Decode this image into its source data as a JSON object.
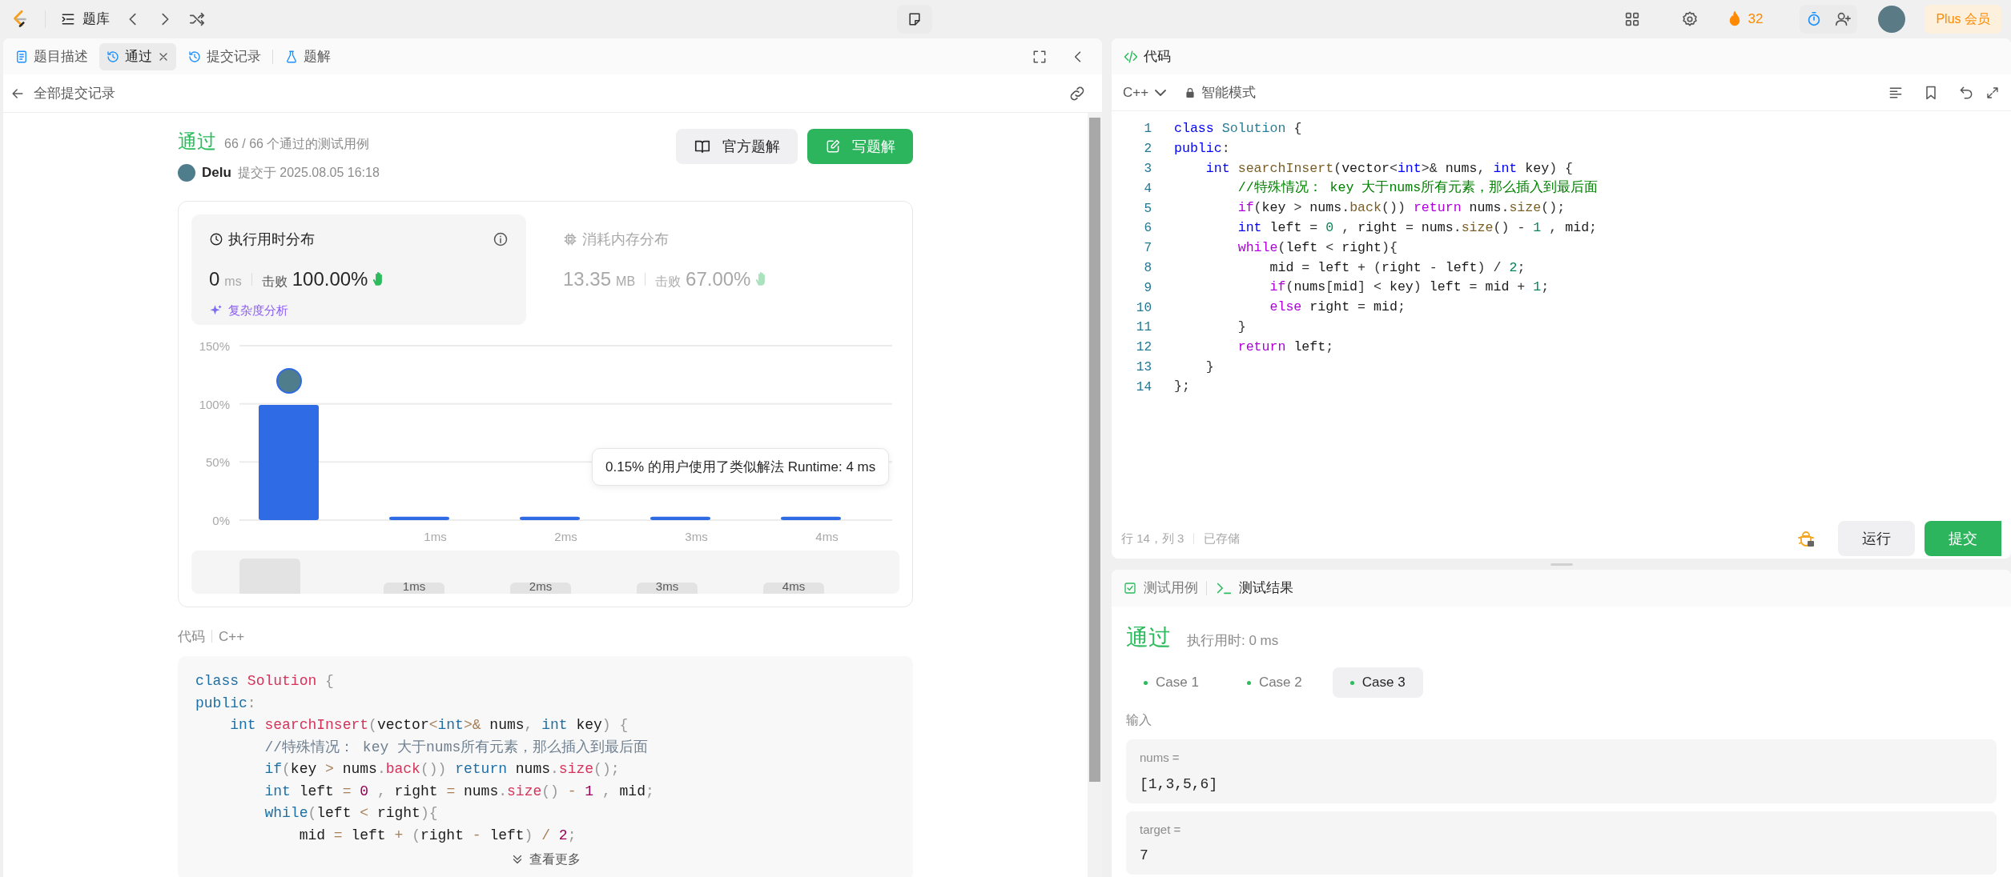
{
  "top_bar": {
    "problem_list": "题库",
    "streak": "32",
    "plus_button": "Plus 会员"
  },
  "left_tabs": [
    {
      "label": "题目描述",
      "selected": false,
      "closable": false
    },
    {
      "label": "通过",
      "selected": true,
      "closable": true
    },
    {
      "label": "提交记录",
      "selected": false,
      "closable": false
    },
    {
      "label": "题解",
      "selected": false,
      "closable": false
    }
  ],
  "back_link": "全部提交记录",
  "submission": {
    "status": "通过",
    "cases": "66 / 66 个通过的测试用例",
    "user": "Delu",
    "submitted": "提交于 2025.08.05 16:18",
    "buttons": [
      {
        "label": "官方题解",
        "kind": "secondary"
      },
      {
        "label": "写题解",
        "kind": "primary"
      }
    ]
  },
  "stats": [
    {
      "title": "执行用时分布",
      "value": "0",
      "unit": "ms",
      "beat_label": "击败",
      "beat": "100.00%",
      "selected": true
    },
    {
      "title": "消耗内存分布",
      "value": "13.35",
      "unit": "MB",
      "beat_label": "击败",
      "beat": "67.00%",
      "selected": false
    }
  ],
  "complexity_link": "复杂度分析",
  "chart_data": {
    "type": "bar",
    "categories": [
      null,
      "1ms",
      "2ms",
      "3ms",
      "4ms"
    ],
    "series": [
      {
        "color": "#2f6be4",
        "values": [
          99,
          3,
          3,
          3,
          3
        ]
      }
    ],
    "ylim": [
      0,
      150
    ],
    "yticks": [
      {
        "value": 0,
        "label": "0%"
      },
      {
        "value": 50,
        "label": "50%"
      },
      {
        "value": 100,
        "label": "100%"
      },
      {
        "value": 150,
        "label": "150%"
      }
    ],
    "annotations": [
      "0.15% 的用户使用了类似解法 Runtime: 4 ms"
    ]
  },
  "overview_labels": [
    "1ms",
    "2ms",
    "3ms",
    "4ms"
  ],
  "code_preview": {
    "label": "代码",
    "language": "C++",
    "more": "查看更多",
    "lines": [
      "class Solution {",
      "public:",
      "    int searchInsert(vector<int>& nums, int key) {",
      "        //特殊情况： key 大于nums所有元素，那么插入到最后面",
      "        if(key > nums.back()) return nums.size();",
      "        int left = 0 , right = nums.size() - 1 , mid;",
      "        while(left < right){",
      "            mid = left + (right - left) / 2;"
    ]
  },
  "editor": {
    "title": "代码",
    "language": "C++",
    "mode": "智能模式",
    "lines": [
      {
        "n": "1",
        "code": "class Solution {"
      },
      {
        "n": "2",
        "code": "public:"
      },
      {
        "n": "3",
        "code": "    int searchInsert(vector<int>& nums, int key) {"
      },
      {
        "n": "4",
        "code": "        //特殊情况： key 大于nums所有元素，那么插入到最后面"
      },
      {
        "n": "5",
        "code": "        if(key > nums.back()) return nums.size();"
      },
      {
        "n": "6",
        "code": "        int left = 0 , right = nums.size() - 1 , mid;"
      },
      {
        "n": "7",
        "code": "        while(left < right){"
      },
      {
        "n": "8",
        "code": "            mid = left + (right - left) / 2;"
      },
      {
        "n": "9",
        "code": "            if(nums[mid] < key) left = mid + 1;"
      },
      {
        "n": "10",
        "code": "            else right = mid;"
      },
      {
        "n": "11",
        "code": "        }"
      },
      {
        "n": "12",
        "code": "        return left;"
      },
      {
        "n": "13",
        "code": "    }"
      },
      {
        "n": "14",
        "code": "};"
      }
    ],
    "cursor": "行 14，列 3",
    "saved": "已存储",
    "run": "运行",
    "submit": "提交"
  },
  "test_panel": {
    "tabs": [
      {
        "label": "测试用例",
        "selected": false
      },
      {
        "label": "测试结果",
        "selected": true
      }
    ],
    "status": "通过",
    "runtime": "执行用时: 0 ms",
    "cases": [
      {
        "label": "Case 1",
        "selected": false
      },
      {
        "label": "Case 2",
        "selected": false
      },
      {
        "label": "Case 3",
        "selected": true
      }
    ],
    "input_label": "输入",
    "inputs": [
      {
        "name": "nums =",
        "value": "[1,3,5,6]"
      },
      {
        "name": "target =",
        "value": "7"
      }
    ]
  }
}
